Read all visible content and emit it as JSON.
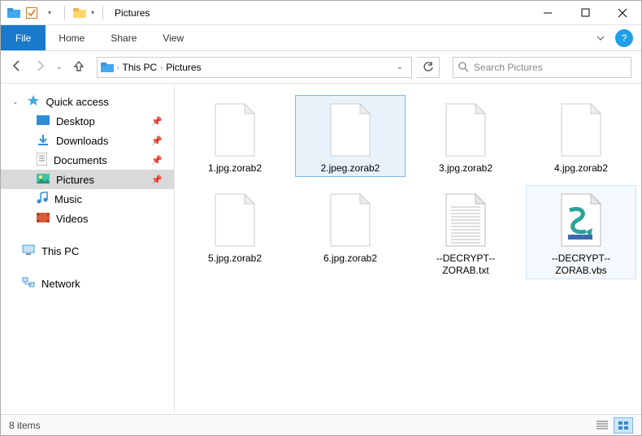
{
  "titlebar": {
    "app_title": "Pictures"
  },
  "ribbon": {
    "file": "File",
    "tabs": [
      "Home",
      "Share",
      "View"
    ]
  },
  "breadcrumb": {
    "items": [
      "This PC",
      "Pictures"
    ]
  },
  "search": {
    "placeholder": "Search Pictures"
  },
  "sidebar": {
    "quick_access": "Quick access",
    "items": [
      {
        "label": "Desktop"
      },
      {
        "label": "Downloads"
      },
      {
        "label": "Documents"
      },
      {
        "label": "Pictures",
        "selected": true
      },
      {
        "label": "Music"
      },
      {
        "label": "Videos"
      }
    ],
    "this_pc": "This PC",
    "network": "Network"
  },
  "files": [
    {
      "name": "1.jpg.zorab2",
      "kind": "blank"
    },
    {
      "name": "2.jpeg.zorab2",
      "kind": "blank",
      "selected": true
    },
    {
      "name": "3.jpg.zorab2",
      "kind": "blank"
    },
    {
      "name": "4.jpg.zorab2",
      "kind": "blank"
    },
    {
      "name": "5.jpg.zorab2",
      "kind": "blank"
    },
    {
      "name": "6.jpg.zorab2",
      "kind": "blank"
    },
    {
      "name": "--DECRYPT--ZORAB.txt",
      "kind": "txt"
    },
    {
      "name": "--DECRYPT--ZORAB.vbs",
      "kind": "vbs",
      "hover": true
    }
  ],
  "status": {
    "count": "8 items"
  }
}
